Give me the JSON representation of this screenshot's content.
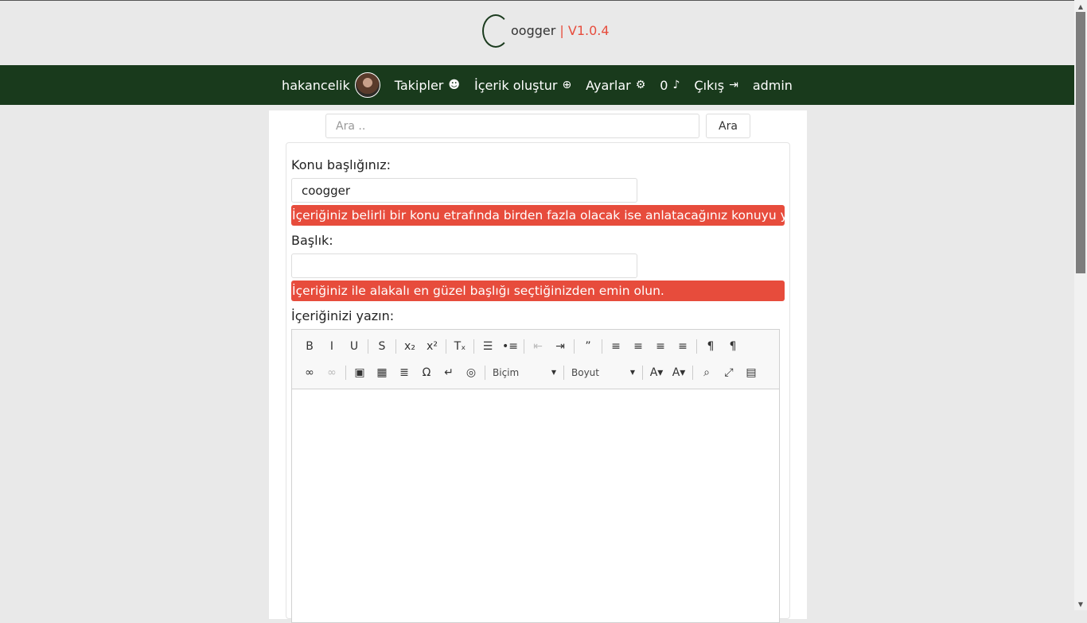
{
  "brand": {
    "name": "oogger",
    "version": " | V1.0.4"
  },
  "nav": {
    "username": "hakancelik",
    "items": [
      {
        "label": "Takipler",
        "icon": "users-icon",
        "glyph": "☻"
      },
      {
        "label": "İçerik oluştur",
        "icon": "plus-circle-icon",
        "glyph": "⊕"
      },
      {
        "label": "Ayarlar",
        "icon": "gear-icon",
        "glyph": "⚙"
      },
      {
        "label": "0",
        "icon": "bell-icon",
        "glyph": "♪"
      },
      {
        "label": "Çıkış",
        "icon": "sign-out-icon",
        "glyph": "⇥"
      },
      {
        "label": "admin",
        "icon": "",
        "glyph": ""
      }
    ]
  },
  "search": {
    "placeholder": "Ara ..",
    "button_label": "Ara"
  },
  "form": {
    "topic_label": "Konu başlığınız:",
    "topic_value": "coogger",
    "topic_hint": "İçeriğiniz belirli bir konu etrafında birden fazla olacak ise anlatacağınız konuyu yazın",
    "title_label": "Başlık:",
    "title_value": "",
    "title_hint": "İçeriğiniz ile alakalı en güzel başlığı seçtiğinizden emin olun.",
    "content_label": "İçeriğinizi yazın:"
  },
  "editor": {
    "format_label": "Biçim",
    "size_label": "Boyut",
    "row1": [
      {
        "name": "bold-icon",
        "g": "B"
      },
      {
        "name": "italic-icon",
        "g": "I"
      },
      {
        "name": "underline-icon",
        "g": "U"
      },
      {
        "sep": true
      },
      {
        "name": "strikethrough-icon",
        "g": "S"
      },
      {
        "sep": true
      },
      {
        "name": "subscript-icon",
        "g": "x₂"
      },
      {
        "name": "superscript-icon",
        "g": "x²"
      },
      {
        "sep": true
      },
      {
        "name": "remove-format-icon",
        "g": "Tₓ"
      },
      {
        "sep": true
      },
      {
        "name": "numbered-list-icon",
        "g": "☰"
      },
      {
        "name": "bulleted-list-icon",
        "g": "•≡"
      },
      {
        "sep": true
      },
      {
        "name": "outdent-icon",
        "g": "⇤",
        "disabled": true
      },
      {
        "name": "indent-icon",
        "g": "⇥"
      },
      {
        "sep": true
      },
      {
        "name": "blockquote-icon",
        "g": "”"
      },
      {
        "sep": true
      },
      {
        "name": "align-left-icon",
        "g": "≡"
      },
      {
        "name": "align-center-icon",
        "g": "≡"
      },
      {
        "name": "align-right-icon",
        "g": "≡"
      },
      {
        "name": "justify-icon",
        "g": "≡"
      },
      {
        "sep": true
      },
      {
        "name": "ltr-icon",
        "g": "¶"
      },
      {
        "name": "rtl-icon",
        "g": "¶"
      }
    ],
    "row2": [
      {
        "name": "link-icon",
        "g": "∞"
      },
      {
        "name": "unlink-icon",
        "g": "∞",
        "disabled": true
      },
      {
        "sep": true
      },
      {
        "name": "image-icon",
        "g": "▣"
      },
      {
        "name": "table-icon",
        "g": "▦"
      },
      {
        "name": "horizontal-line-icon",
        "g": "≣"
      },
      {
        "name": "special-char-icon",
        "g": "Ω"
      },
      {
        "name": "page-break-icon",
        "g": "↵"
      },
      {
        "name": "iframe-icon",
        "g": "◎"
      }
    ],
    "row2b": [
      {
        "name": "text-color-icon",
        "g": "A▾"
      },
      {
        "name": "bg-color-icon",
        "g": "A▾"
      },
      {
        "sep": true
      },
      {
        "name": "preview-icon",
        "g": "⌕"
      },
      {
        "name": "maximize-icon",
        "g": "⤢"
      },
      {
        "name": "show-blocks-icon",
        "g": "▤"
      }
    ]
  }
}
